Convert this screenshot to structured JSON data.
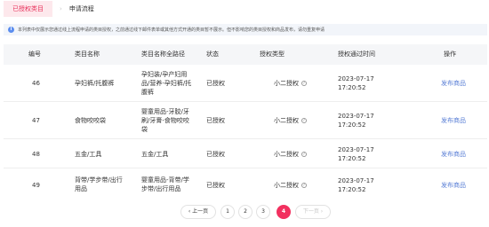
{
  "tabs": {
    "active": "已授权类目",
    "separator": "›",
    "second": "申请流程"
  },
  "notice": {
    "text": "本列表中仅展示您通过线上流程申请的类目授权，之前通过线下邮件表单或其他方式开通的类目暂不展示。但不影响您的类目授权和商品发布，请勿重复申请"
  },
  "table": {
    "columns": [
      "编号",
      "类目名称",
      "类目名称全路径",
      "状态",
      "授权类型",
      "授权通过时间",
      "操作"
    ],
    "rows": [
      {
        "id": "46",
        "name": "孕妇裤/托腹裤",
        "path": "孕妇装/孕产妇用品/营养-孕妇裤/托腹裤",
        "status": "已授权",
        "auth_type": "小二授权",
        "time": "2023-07-17 17:20:52",
        "action": "发布商品"
      },
      {
        "id": "47",
        "name": "食物咬咬袋",
        "path": "婴童用品-牙胶/牙刷/牙膏-食物咬咬袋",
        "status": "已授权",
        "auth_type": "小二授权",
        "time": "2023-07-17 17:20:52",
        "action": "发布商品"
      },
      {
        "id": "48",
        "name": "五金/工具",
        "path": "五金/工具",
        "status": "已授权",
        "auth_type": "小二授权",
        "time": "2023-07-17 17:20:52",
        "action": "发布商品"
      },
      {
        "id": "49",
        "name": "背带/学步带/出行用品",
        "path": "婴童用品-背带/学步带/出行用品",
        "status": "已授权",
        "auth_type": "小二授权",
        "time": "2023-07-17 17:20:52",
        "action": "发布商品"
      }
    ]
  },
  "pagination": {
    "prev": "‹ 上一页",
    "pages": [
      "1",
      "2",
      "3",
      "4"
    ],
    "current": "4",
    "next": "下一页 ›"
  },
  "colors": {
    "accent": "#f2305f",
    "tab_bg": "#fde8ec",
    "link": "#5a7fd6",
    "header_bg": "#f5f6f8",
    "notice_bg": "#f2f5fa",
    "notice_icon": "#5b8def"
  },
  "icons": {
    "notice": "info-icon",
    "auth_type_help": "question-circle-icon"
  }
}
